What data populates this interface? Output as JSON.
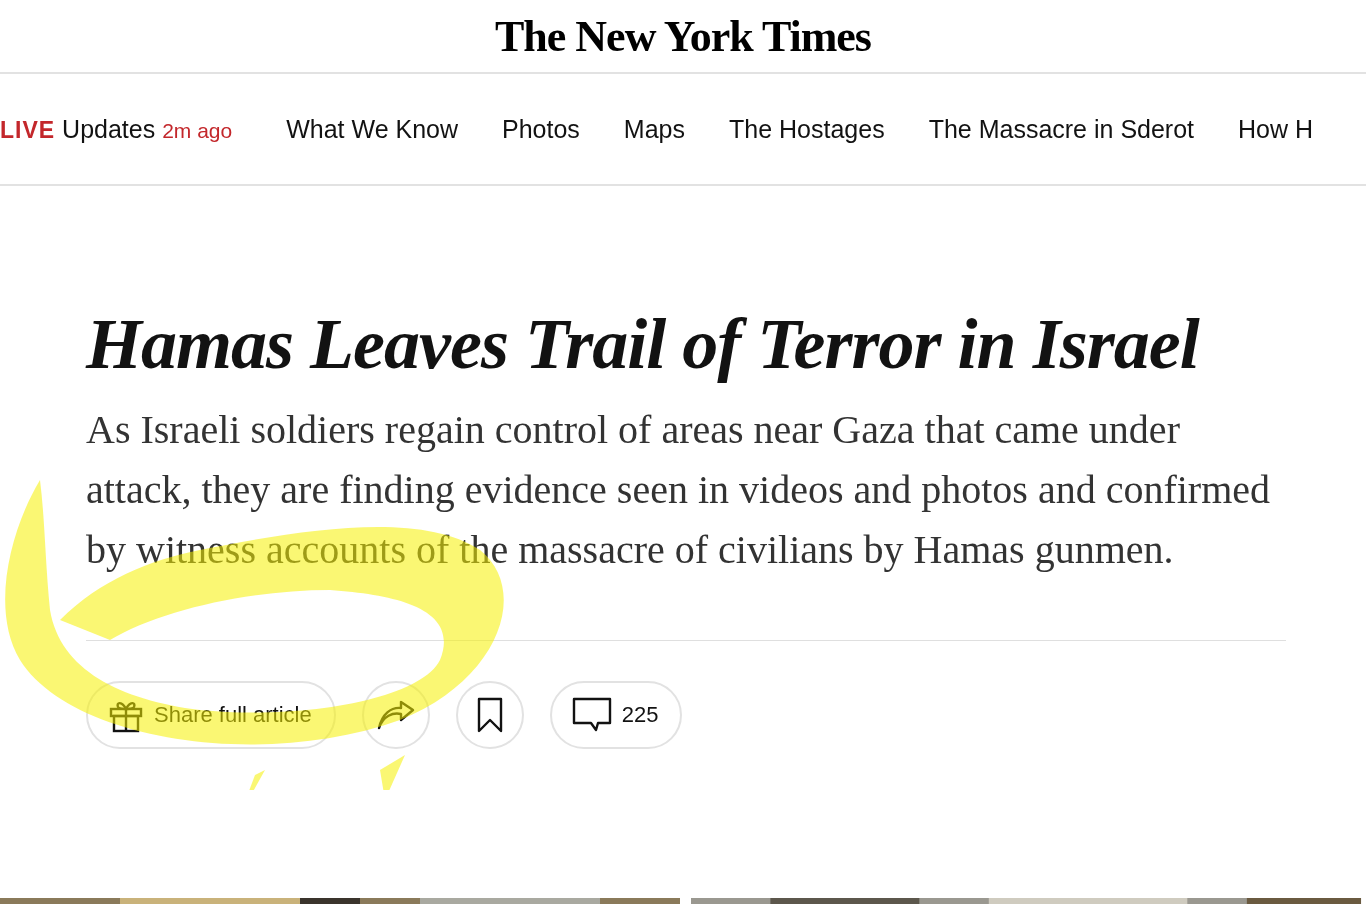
{
  "masthead": {
    "logo": "The New York Times"
  },
  "nav": {
    "live": {
      "badge": "LIVE",
      "label": "Updates",
      "time": "2m ago"
    },
    "items": [
      "What We Know",
      "Photos",
      "Maps",
      "The Hostages",
      "The Massacre in Sderot",
      "How H"
    ]
  },
  "article": {
    "headline": "Hamas Leaves Trail of Terror in Israel",
    "summary": "As Israeli soldiers regain control of areas near Gaza that came under attack, they are finding evidence seen in videos and photos and confirmed by witness accounts of the massacre of civilians by Hamas gunmen."
  },
  "actions": {
    "share_full": "Share full article",
    "comment_count": "225"
  }
}
